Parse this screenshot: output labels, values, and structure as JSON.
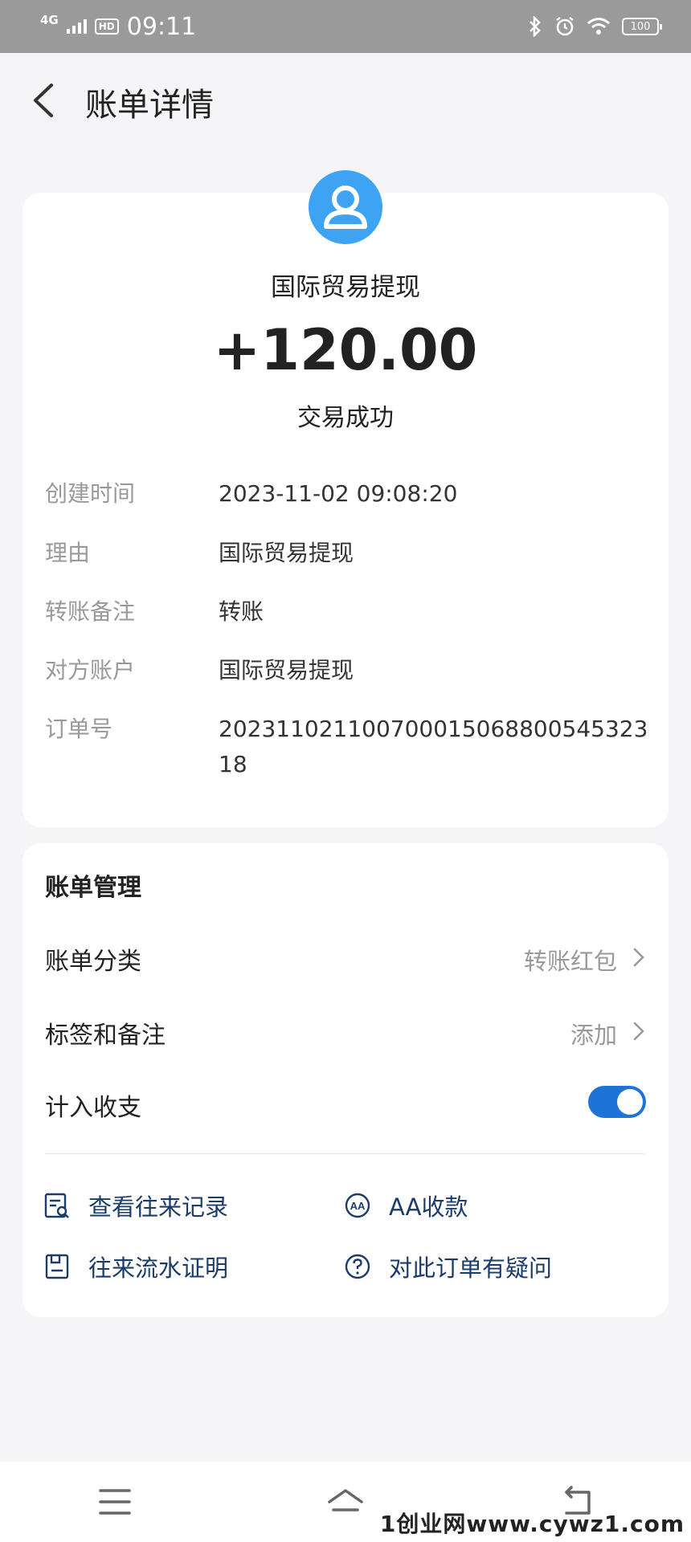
{
  "status_bar": {
    "network": "4G",
    "hd_badge": "HD",
    "time": "09:11",
    "battery": "100"
  },
  "header": {
    "title": "账单详情"
  },
  "transaction": {
    "payee": "国际贸易提现",
    "amount": "+120.00",
    "status": "交易成功",
    "details": [
      {
        "label": "创建时间",
        "value": "2023-11-02 09:08:20"
      },
      {
        "label": "理由",
        "value": "国际贸易提现"
      },
      {
        "label": "转账备注",
        "value": "转账"
      },
      {
        "label": "对方账户",
        "value": "国际贸易提现"
      },
      {
        "label": "订单号",
        "value": "20231102110070001506880054532318"
      }
    ]
  },
  "management": {
    "title": "账单管理",
    "category_label": "账单分类",
    "category_value": "转账红包",
    "tags_label": "标签和备注",
    "tags_value": "添加",
    "count_label": "计入收支",
    "count_enabled": true,
    "actions": [
      {
        "label": "查看往来记录",
        "icon": "record-search-icon"
      },
      {
        "label": "AA收款",
        "icon": "aa-icon"
      },
      {
        "label": "往来流水证明",
        "icon": "document-icon"
      },
      {
        "label": "对此订单有疑问",
        "icon": "question-icon"
      }
    ]
  },
  "watermark": "1创业网www.cywz1.com",
  "colors": {
    "accent": "#1e73d6",
    "avatar": "#3fa3f3",
    "action_text": "#1b3b6a"
  }
}
